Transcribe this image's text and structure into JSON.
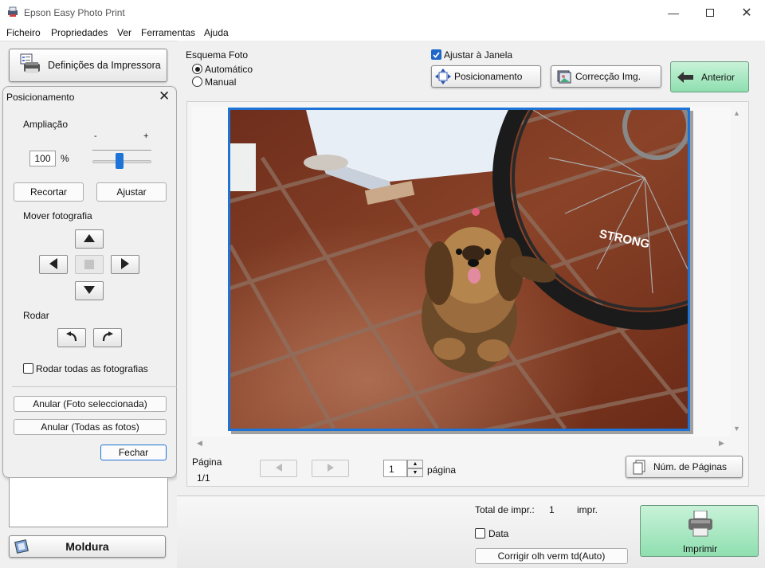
{
  "window": {
    "title": "Epson Easy Photo Print"
  },
  "menu": [
    "Ficheiro",
    "Propriedades",
    "Ver",
    "Ferramentas",
    "Ajuda"
  ],
  "left": {
    "printer_settings": "Definições da Impressora",
    "frame_button": "Moldura"
  },
  "positioning": {
    "title": "Posicionamento",
    "zoom_label": "Ampliação",
    "zoom_minus": "-",
    "zoom_plus": "+",
    "zoom_value": "100",
    "zoom_unit": "%",
    "zoom_level": 0.45,
    "crop": "Recortar",
    "fit": "Ajustar",
    "move_label": "Mover fotografia",
    "rotate_label": "Rodar",
    "rotate_all": "Rodar todas as fotografias",
    "undo_selected": "Anular (Foto seleccionada)",
    "undo_all": "Anular (Todas as fotos)",
    "close": "Fechar"
  },
  "layout_opts": {
    "label": "Esquema Foto",
    "auto": "Automático",
    "manual": "Manual",
    "fit_window": "Ajustar à Janela",
    "fit_window_checked": true
  },
  "toolbar": {
    "positioning": "Posicionamento",
    "image_correction": "Correcção Img.",
    "back": "Anterior"
  },
  "page": {
    "label": "Página",
    "value": "1/1",
    "spinner_value": "1",
    "unit": "página",
    "num_pages": "Núm. de Páginas"
  },
  "bottom": {
    "total_label": "Total de impr.:",
    "total_value": "1",
    "total_unit": "impr.",
    "date_label": "Data",
    "redeye": "Corrigir olh verm td(Auto)",
    "print": "Imprimir"
  },
  "colors": {
    "accent": "#1e73d6",
    "print_green": "#a6e8c0"
  }
}
